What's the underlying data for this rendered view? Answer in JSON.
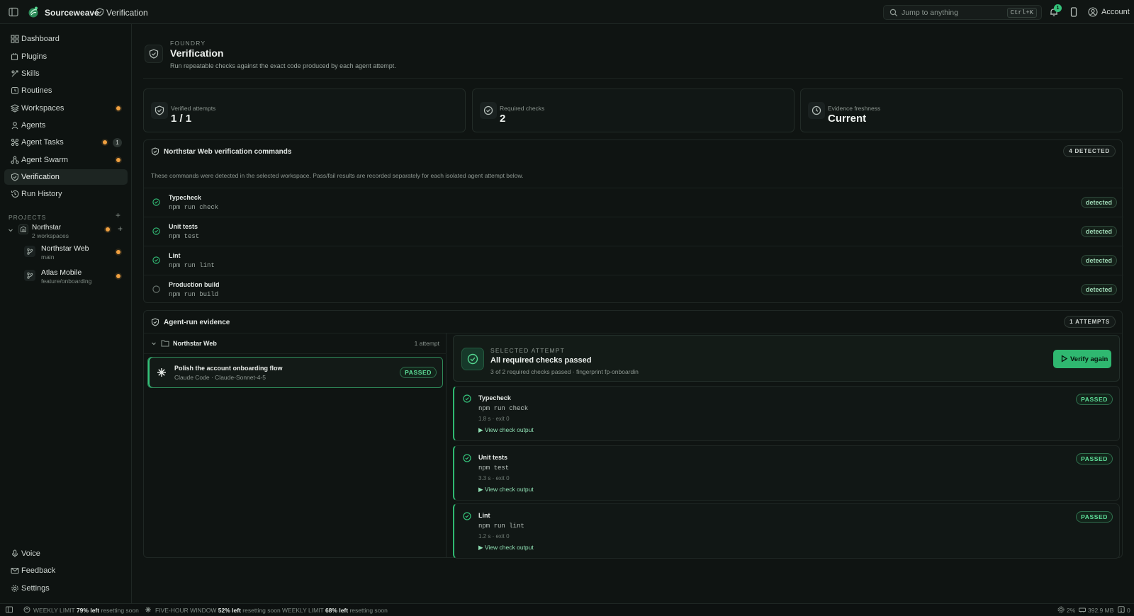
{
  "topbar": {
    "app_name": "Sourceweave",
    "breadcrumb": "Verification",
    "search_placeholder": "Jump to anything",
    "search_shortcut": "Ctrl+K",
    "notification_count": "1",
    "account_label": "Account"
  },
  "sidebar": {
    "items": [
      {
        "label": "Dashboard",
        "icon": "dashboard-icon"
      },
      {
        "label": "Plugins",
        "icon": "plugin-icon"
      },
      {
        "label": "Skills",
        "icon": "skills-icon"
      },
      {
        "label": "Routines",
        "icon": "routines-icon"
      },
      {
        "label": "Workspaces",
        "icon": "layers-icon",
        "dot": true
      },
      {
        "label": "Agents",
        "icon": "user-icon"
      },
      {
        "label": "Agent Tasks",
        "icon": "tasks-icon",
        "dot": true,
        "count": "1"
      },
      {
        "label": "Agent Swarm",
        "icon": "swarm-icon",
        "dot": true
      },
      {
        "label": "Verification",
        "icon": "shield-icon",
        "active": true
      },
      {
        "label": "Run History",
        "icon": "history-icon"
      }
    ],
    "projects_header": "PROJECTS",
    "project": {
      "name": "Northstar",
      "sub": "2 workspaces"
    },
    "workspaces": [
      {
        "name": "Northstar Web",
        "branch": "main"
      },
      {
        "name": "Atlas Mobile",
        "branch": "feature/onboarding"
      }
    ],
    "footer_items": [
      {
        "label": "Voice",
        "icon": "mic-icon"
      },
      {
        "label": "Feedback",
        "icon": "mail-icon"
      },
      {
        "label": "Settings",
        "icon": "gear-icon"
      }
    ]
  },
  "header": {
    "eyebrow": "FOUNDRY",
    "title": "Verification",
    "subtitle": "Run repeatable checks against the exact code produced by each agent attempt."
  },
  "stats": [
    {
      "label": "Verified attempts",
      "value": "1 / 1",
      "icon": "shield-icon"
    },
    {
      "label": "Required checks",
      "value": "2",
      "icon": "check-circle-icon"
    },
    {
      "label": "Evidence freshness",
      "value": "Current",
      "icon": "clock-icon"
    }
  ],
  "commands_panel": {
    "title": "Northstar Web verification commands",
    "badge": "4 DETECTED",
    "description": "These commands were detected in the selected workspace. Pass/fail results are recorded separately for each isolated agent attempt below.",
    "commands": [
      {
        "title": "Typecheck",
        "command": "npm run check",
        "status": "detected",
        "required": true
      },
      {
        "title": "Unit tests",
        "command": "npm test",
        "status": "detected",
        "required": true
      },
      {
        "title": "Lint",
        "command": "npm run lint",
        "status": "detected",
        "required": true
      },
      {
        "title": "Production build",
        "command": "npm run build",
        "status": "detected",
        "required": false
      }
    ]
  },
  "evidence_panel": {
    "title": "Agent-run evidence",
    "badge": "1 ATTEMPTS",
    "group": {
      "name": "Northstar Web",
      "count": "1 attempt"
    },
    "attempt": {
      "title": "Polish the account onboarding flow",
      "sub": "Claude Code · Claude-Sonnet-4-5",
      "status": "PASSED"
    },
    "selected": {
      "eyebrow": "SELECTED ATTEMPT",
      "title": "All required checks passed",
      "sub": "3 of 2 required checks passed · fingerprint fp-onboardin",
      "button": "Verify again"
    },
    "checks": [
      {
        "title": "Typecheck",
        "command": "npm run check",
        "meta": "1.8 s · exit 0",
        "link": "▶ View check output",
        "status": "PASSED"
      },
      {
        "title": "Unit tests",
        "command": "npm test",
        "meta": "3.3 s · exit 0",
        "link": "▶ View check output",
        "status": "PASSED"
      },
      {
        "title": "Lint",
        "command": "npm run lint",
        "meta": "1.2 s · exit 0",
        "link": "▶ View check output",
        "status": "PASSED"
      }
    ]
  },
  "statusbar": {
    "weekly1_label": "WEEKLY LIMIT",
    "weekly1_value": "79% left",
    "weekly1_reset": "resetting soon",
    "five_label": "FIVE-HOUR WINDOW",
    "five_value": "52% left",
    "five_reset": "resetting soon",
    "weekly2_label": "WEEKLY LIMIT",
    "weekly2_value": "68% left",
    "weekly2_reset": "resetting soon",
    "cpu": "2%",
    "memory": "392.9 MB",
    "alerts": "0"
  },
  "colors": {
    "background": "#0f1412",
    "accent": "#2fb870",
    "dot": "#f0a040"
  }
}
